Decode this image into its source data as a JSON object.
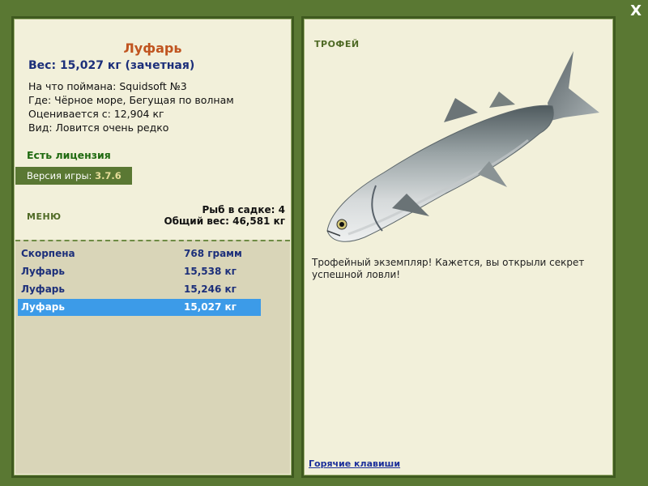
{
  "window": {
    "close_label": "X"
  },
  "fish": {
    "name": "Луфарь",
    "weight_line": "Вес: 15,027 кг (зачетная)",
    "caught_on": "На что поймана: Squidsoft №3",
    "location": "Где: Чёрное море, Бегущая по волнам",
    "valued_from": "Оценивается с: 12,904 кг",
    "rarity": "Вид: Ловится очень редко"
  },
  "license": "Есть лицензия",
  "version": {
    "label": "Версия игры:",
    "value": "3.7.6"
  },
  "menu_label": "МЕНЮ",
  "cage": {
    "count": "Рыб в садке: 4",
    "total_weight": "Общий вес: 46,581 кг"
  },
  "catch_list": [
    {
      "name": "Скорпена",
      "weight": "768 грамм"
    },
    {
      "name": "Луфарь",
      "weight": "15,538 кг"
    },
    {
      "name": "Луфарь",
      "weight": "15,246 кг"
    },
    {
      "name": "Луфарь",
      "weight": "15,027 кг",
      "selected": true
    }
  ],
  "trophy": {
    "label": "ТРОФЕЙ",
    "image_icon": "bluefish-photo",
    "description": "Трофейный экземпляр! Кажется, вы открыли секрет успешной ловли!"
  },
  "hotkeys_link": "Горячие клавиши",
  "colors": {
    "background": "#5a7833",
    "panel": "#f2f0da",
    "list_bg": "#d9d5b8",
    "title": "#c0541f",
    "accent_blue": "#1c2f7a",
    "selection": "#3c9be8"
  }
}
